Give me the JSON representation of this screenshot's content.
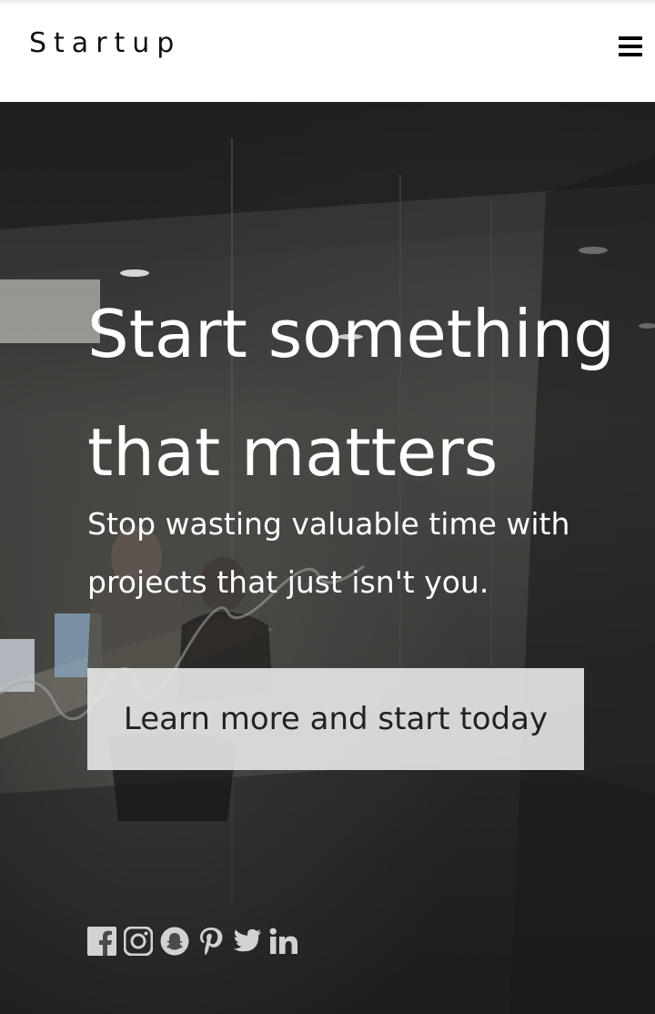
{
  "header": {
    "logo": "Startup",
    "menu_icon": "hamburger-menu-icon"
  },
  "hero": {
    "headline": "Start something that matters",
    "subline": "Stop wasting valuable time with projects that just isn't you.",
    "cta_label": "Learn more and start today",
    "colors": {
      "button_bg": "#e4e4e4",
      "text": "#ffffff",
      "icon": "#d2d2d2"
    }
  },
  "social": [
    "facebook-icon",
    "instagram-icon",
    "snapchat-icon",
    "pinterest-icon",
    "twitter-icon",
    "linkedin-icon"
  ]
}
